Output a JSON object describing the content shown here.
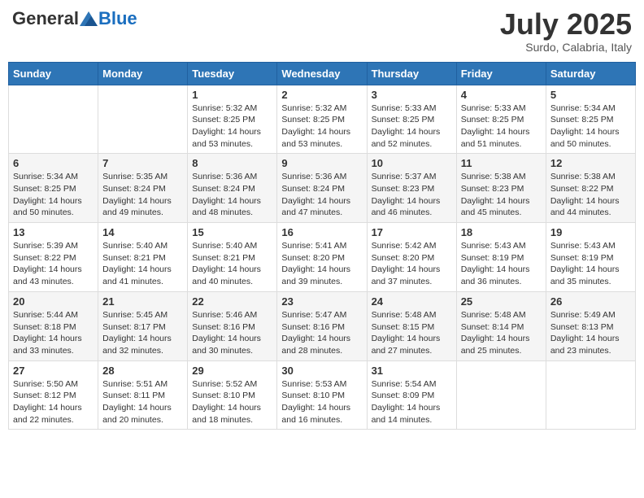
{
  "logo": {
    "general": "General",
    "blue": "Blue"
  },
  "title": "July 2025",
  "subtitle": "Surdo, Calabria, Italy",
  "days_of_week": [
    "Sunday",
    "Monday",
    "Tuesday",
    "Wednesday",
    "Thursday",
    "Friday",
    "Saturday"
  ],
  "weeks": [
    [
      {
        "day": "",
        "info": ""
      },
      {
        "day": "",
        "info": ""
      },
      {
        "day": "1",
        "info": "Sunrise: 5:32 AM\nSunset: 8:25 PM\nDaylight: 14 hours and 53 minutes."
      },
      {
        "day": "2",
        "info": "Sunrise: 5:32 AM\nSunset: 8:25 PM\nDaylight: 14 hours and 53 minutes."
      },
      {
        "day": "3",
        "info": "Sunrise: 5:33 AM\nSunset: 8:25 PM\nDaylight: 14 hours and 52 minutes."
      },
      {
        "day": "4",
        "info": "Sunrise: 5:33 AM\nSunset: 8:25 PM\nDaylight: 14 hours and 51 minutes."
      },
      {
        "day": "5",
        "info": "Sunrise: 5:34 AM\nSunset: 8:25 PM\nDaylight: 14 hours and 50 minutes."
      }
    ],
    [
      {
        "day": "6",
        "info": "Sunrise: 5:34 AM\nSunset: 8:25 PM\nDaylight: 14 hours and 50 minutes."
      },
      {
        "day": "7",
        "info": "Sunrise: 5:35 AM\nSunset: 8:24 PM\nDaylight: 14 hours and 49 minutes."
      },
      {
        "day": "8",
        "info": "Sunrise: 5:36 AM\nSunset: 8:24 PM\nDaylight: 14 hours and 48 minutes."
      },
      {
        "day": "9",
        "info": "Sunrise: 5:36 AM\nSunset: 8:24 PM\nDaylight: 14 hours and 47 minutes."
      },
      {
        "day": "10",
        "info": "Sunrise: 5:37 AM\nSunset: 8:23 PM\nDaylight: 14 hours and 46 minutes."
      },
      {
        "day": "11",
        "info": "Sunrise: 5:38 AM\nSunset: 8:23 PM\nDaylight: 14 hours and 45 minutes."
      },
      {
        "day": "12",
        "info": "Sunrise: 5:38 AM\nSunset: 8:22 PM\nDaylight: 14 hours and 44 minutes."
      }
    ],
    [
      {
        "day": "13",
        "info": "Sunrise: 5:39 AM\nSunset: 8:22 PM\nDaylight: 14 hours and 43 minutes."
      },
      {
        "day": "14",
        "info": "Sunrise: 5:40 AM\nSunset: 8:21 PM\nDaylight: 14 hours and 41 minutes."
      },
      {
        "day": "15",
        "info": "Sunrise: 5:40 AM\nSunset: 8:21 PM\nDaylight: 14 hours and 40 minutes."
      },
      {
        "day": "16",
        "info": "Sunrise: 5:41 AM\nSunset: 8:20 PM\nDaylight: 14 hours and 39 minutes."
      },
      {
        "day": "17",
        "info": "Sunrise: 5:42 AM\nSunset: 8:20 PM\nDaylight: 14 hours and 37 minutes."
      },
      {
        "day": "18",
        "info": "Sunrise: 5:43 AM\nSunset: 8:19 PM\nDaylight: 14 hours and 36 minutes."
      },
      {
        "day": "19",
        "info": "Sunrise: 5:43 AM\nSunset: 8:19 PM\nDaylight: 14 hours and 35 minutes."
      }
    ],
    [
      {
        "day": "20",
        "info": "Sunrise: 5:44 AM\nSunset: 8:18 PM\nDaylight: 14 hours and 33 minutes."
      },
      {
        "day": "21",
        "info": "Sunrise: 5:45 AM\nSunset: 8:17 PM\nDaylight: 14 hours and 32 minutes."
      },
      {
        "day": "22",
        "info": "Sunrise: 5:46 AM\nSunset: 8:16 PM\nDaylight: 14 hours and 30 minutes."
      },
      {
        "day": "23",
        "info": "Sunrise: 5:47 AM\nSunset: 8:16 PM\nDaylight: 14 hours and 28 minutes."
      },
      {
        "day": "24",
        "info": "Sunrise: 5:48 AM\nSunset: 8:15 PM\nDaylight: 14 hours and 27 minutes."
      },
      {
        "day": "25",
        "info": "Sunrise: 5:48 AM\nSunset: 8:14 PM\nDaylight: 14 hours and 25 minutes."
      },
      {
        "day": "26",
        "info": "Sunrise: 5:49 AM\nSunset: 8:13 PM\nDaylight: 14 hours and 23 minutes."
      }
    ],
    [
      {
        "day": "27",
        "info": "Sunrise: 5:50 AM\nSunset: 8:12 PM\nDaylight: 14 hours and 22 minutes."
      },
      {
        "day": "28",
        "info": "Sunrise: 5:51 AM\nSunset: 8:11 PM\nDaylight: 14 hours and 20 minutes."
      },
      {
        "day": "29",
        "info": "Sunrise: 5:52 AM\nSunset: 8:10 PM\nDaylight: 14 hours and 18 minutes."
      },
      {
        "day": "30",
        "info": "Sunrise: 5:53 AM\nSunset: 8:10 PM\nDaylight: 14 hours and 16 minutes."
      },
      {
        "day": "31",
        "info": "Sunrise: 5:54 AM\nSunset: 8:09 PM\nDaylight: 14 hours and 14 minutes."
      },
      {
        "day": "",
        "info": ""
      },
      {
        "day": "",
        "info": ""
      }
    ]
  ]
}
